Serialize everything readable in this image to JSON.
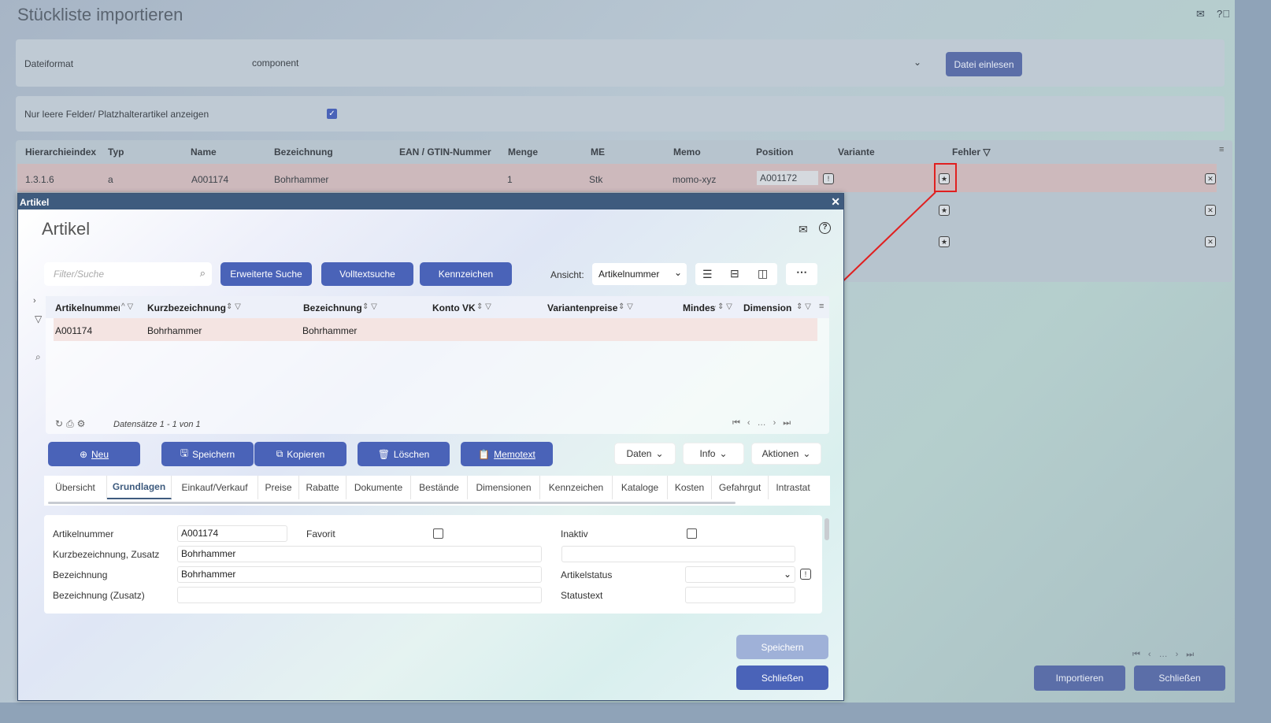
{
  "background": {
    "title": "Stückliste importieren",
    "dateiformat_label": "Dateiformat",
    "dateiformat_value": "component",
    "datei_einlesen": "Datei einlesen",
    "leere_felder_label": "Nur leere Felder/ Platzhalterartikel anzeigen",
    "columns": [
      "Hierarchieindex",
      "Typ",
      "Name",
      "Bezeichnung",
      "EAN / GTIN-Nummer",
      "Menge",
      "ME",
      "Memo",
      "Position",
      "Variante",
      "Fehler"
    ],
    "row": {
      "hierarchieindex": "1.3.1.6",
      "typ": "a",
      "name": "A001174",
      "bezeichnung": "Bohrhammer",
      "menge": "1",
      "me": "Stk",
      "memo": "momo-xyz",
      "position": "A001172"
    },
    "importieren": "Importieren",
    "schliessen": "Schließen"
  },
  "modal": {
    "bar_title": "Artikel",
    "title": "Artikel",
    "search_placeholder": "Filter/Suche",
    "erweiterte_suche": "Erweiterte Suche",
    "volltextsuche": "Volltextsuche",
    "kennzeichen": "Kennzeichen",
    "ansicht_label": "Ansicht:",
    "ansicht_value": "Artikelnummer",
    "grid_columns": [
      "Artikelnummer",
      "Kurzbezeichnung",
      "Bezeichnung",
      "Konto VK",
      "Variantenpreise",
      "Mindest",
      "Dimension"
    ],
    "grid_row": {
      "artikelnummer": "A001174",
      "kurzbezeichnung": "Bohrhammer",
      "bezeichnung": "Bohrhammer"
    },
    "datensaetze": "Datensätze 1 - 1 von 1",
    "actions": {
      "neu": "Neu",
      "speichern": "Speichern",
      "kopieren": "Kopieren",
      "loeschen": "Löschen",
      "memotext": "Memotext",
      "daten": "Daten",
      "info": "Info",
      "aktionen": "Aktionen"
    },
    "tabs": [
      "Übersicht",
      "Grundlagen",
      "Einkauf/Verkauf",
      "Preise",
      "Rabatte",
      "Dokumente",
      "Bestände",
      "Dimensionen",
      "Kennzeichen",
      "Kataloge",
      "Kosten",
      "Gefahrgut",
      "Intrastat"
    ],
    "active_tab": "Grundlagen",
    "form": {
      "artikelnummer_label": "Artikelnummer",
      "artikelnummer_value": "A001174",
      "favorit_label": "Favorit",
      "inaktiv_label": "Inaktiv",
      "kurzbez_label": "Kurzbezeichnung, Zusatz",
      "kurzbez_value": "Bohrhammer",
      "bezeichnung_label": "Bezeichnung",
      "bezeichnung_value": "Bohrhammer",
      "artikelstatus_label": "Artikelstatus",
      "bez_zusatz_label": "Bezeichnung (Zusatz)",
      "statustext_label": "Statustext"
    },
    "speichern_footer": "Speichern",
    "schliessen_footer": "Schließen"
  },
  "colors": {
    "primary": "#4a63b8",
    "modal_bar": "#3e5b7e",
    "row_highlight": "#f6e6e4",
    "annotation": "#e02020"
  }
}
